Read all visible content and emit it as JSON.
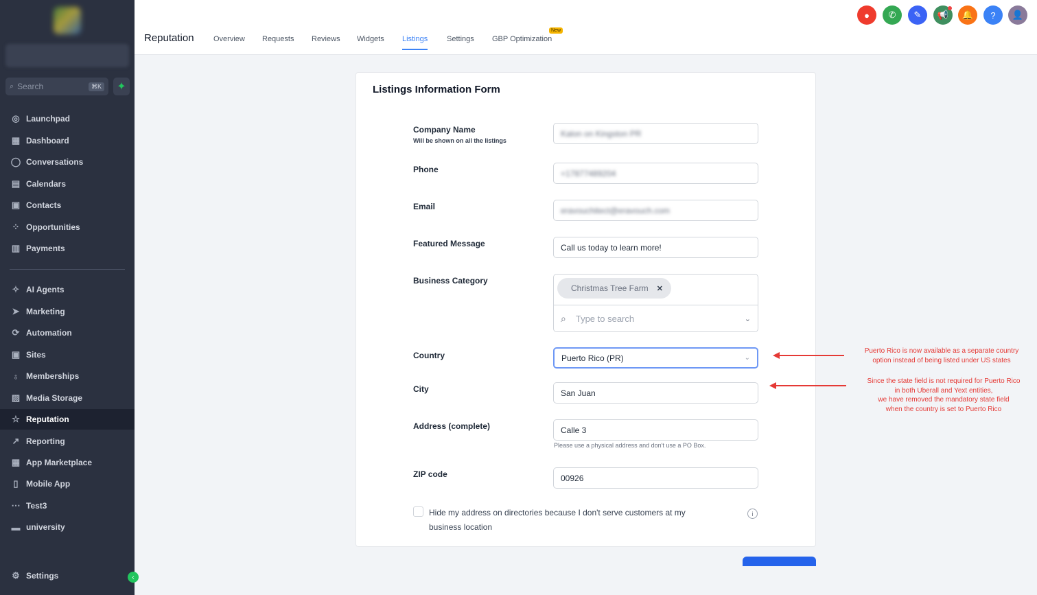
{
  "sidebar": {
    "search_placeholder": "Search",
    "search_shortcut": "⌘K",
    "items": [
      {
        "label": "Launchpad",
        "icon": "launchpad-icon",
        "glyph": "◎"
      },
      {
        "label": "Dashboard",
        "icon": "dashboard-icon",
        "glyph": "▦"
      },
      {
        "label": "Conversations",
        "icon": "chat-icon",
        "glyph": "◯"
      },
      {
        "label": "Calendars",
        "icon": "calendar-icon",
        "glyph": "▤"
      },
      {
        "label": "Contacts",
        "icon": "contacts-icon",
        "glyph": "▣"
      },
      {
        "label": "Opportunities",
        "icon": "opportunities-icon",
        "glyph": "⁘"
      },
      {
        "label": "Payments",
        "icon": "payments-icon",
        "glyph": "▥"
      },
      {
        "label": "AI Agents",
        "icon": "ai-agents-icon",
        "glyph": "✧"
      },
      {
        "label": "Marketing",
        "icon": "marketing-icon",
        "glyph": "➤"
      },
      {
        "label": "Automation",
        "icon": "automation-icon",
        "glyph": "⟳"
      },
      {
        "label": "Sites",
        "icon": "sites-icon",
        "glyph": "▣"
      },
      {
        "label": "Memberships",
        "icon": "memberships-icon",
        "glyph": "♁"
      },
      {
        "label": "Media Storage",
        "icon": "media-storage-icon",
        "glyph": "▨"
      },
      {
        "label": "Reputation",
        "icon": "star-icon",
        "glyph": "☆"
      },
      {
        "label": "Reporting",
        "icon": "reporting-icon",
        "glyph": "↗"
      },
      {
        "label": "App Marketplace",
        "icon": "app-marketplace-icon",
        "glyph": "▦"
      },
      {
        "label": "Mobile App",
        "icon": "mobile-icon",
        "glyph": "▯"
      },
      {
        "label": "Test3",
        "icon": "test3-icon",
        "glyph": "⋯"
      },
      {
        "label": "university",
        "icon": "university-icon",
        "glyph": "▬"
      }
    ],
    "settings_label": "Settings"
  },
  "header": {
    "title": "Reputation",
    "tabs": [
      "Overview",
      "Requests",
      "Reviews",
      "Widgets",
      "Listings",
      "Settings",
      "GBP Optimization"
    ],
    "active_tab": "Listings",
    "new_badge": "New"
  },
  "top_icons": [
    {
      "name": "red-circle-icon",
      "color": "#ef3b2d",
      "glyph": "●"
    },
    {
      "name": "phone-icon",
      "color": "#34a853",
      "glyph": "✆"
    },
    {
      "name": "magic-icon",
      "color": "#3b63f5",
      "glyph": "✎"
    },
    {
      "name": "megaphone-icon",
      "color": "#3f8f5f",
      "glyph": "📢"
    },
    {
      "name": "bell-icon",
      "color": "#f97316",
      "glyph": "🔔"
    },
    {
      "name": "help-icon",
      "color": "#3b82f6",
      "glyph": "?"
    }
  ],
  "form": {
    "title": "Listings Information Form",
    "company_name_label": "Company Name",
    "company_name_sublabel": "Will be shown on all the listings",
    "company_name_value": "Kalon on Kingston PR",
    "phone_label": "Phone",
    "phone_value": "+17877489204",
    "email_label": "Email",
    "email_value": "eravouchitect@eravouch.com",
    "featured_label": "Featured Message",
    "featured_value": "Call us today to learn more!",
    "category_label": "Business Category",
    "category_chip": "Christmas Tree Farm",
    "category_search_placeholder": "Type to search",
    "country_label": "Country",
    "country_value": "Puerto Rico (PR)",
    "city_label": "City",
    "city_value": "San Juan",
    "address_label": "Address (complete)",
    "address_value": "Calle 3",
    "address_helper": "Please use a physical address and don't use a PO Box.",
    "zip_label": "ZIP code",
    "zip_value": "00926",
    "hide_address_text": "Hide my address on directories because I don't serve customers at my business location"
  },
  "annotations": {
    "color": "#e53935",
    "country_note": [
      "Puerto Rico is now available as a separate country",
      "option instead of being listed under US states"
    ],
    "state_note": [
      "Since the state field is not required for Puerto Rico",
      "in both Uberall and Yext entities,",
      "we have removed the mandatory state field",
      "when the country is set to Puerto Rico"
    ]
  }
}
